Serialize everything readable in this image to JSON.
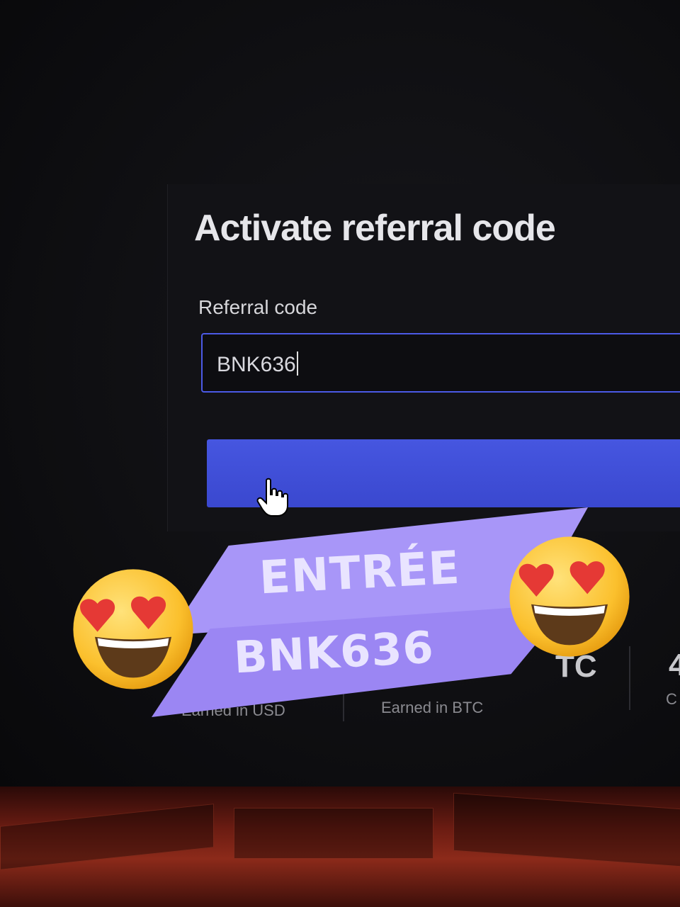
{
  "dialog": {
    "title": "Activate referral code",
    "field_label": "Referral code",
    "field_value": "BNK636"
  },
  "stats": {
    "usd_label": "Earned in USD",
    "btc_value_fragment": "TC",
    "btc_label": "Earned in BTC",
    "third_value_fragment": "4",
    "third_label_fragment": "C"
  },
  "promo": {
    "line1": "ENTRÉE",
    "line2": "BNK636"
  },
  "colors": {
    "accent_blue": "#3f4fd8",
    "input_border": "#4b5ae6",
    "promo_purple": "#a390f6"
  },
  "icons": {
    "pointer": "hand-pointer-icon",
    "emoji": "heart-eyes-emoji"
  }
}
